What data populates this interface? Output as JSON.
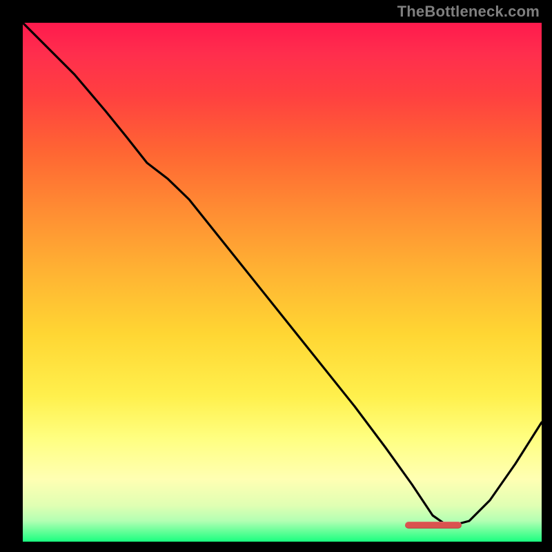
{
  "watermark": {
    "text": "TheBottleneck.com"
  },
  "chart_data": {
    "type": "line",
    "title": "",
    "xlabel": "",
    "ylabel": "",
    "xlim": [
      0,
      100
    ],
    "ylim": [
      0,
      100
    ],
    "grid": false,
    "legend": false,
    "series": [
      {
        "name": "curve",
        "x": [
          0,
          4,
          10,
          16,
          20,
          24,
          28,
          32,
          40,
          48,
          56,
          64,
          70,
          75,
          79,
          82,
          86,
          90,
          95,
          100
        ],
        "values": [
          100,
          96,
          90,
          83,
          78,
          73,
          70,
          66,
          56,
          46,
          36,
          26,
          18,
          11,
          5,
          3,
          4,
          8,
          15,
          23
        ]
      }
    ],
    "annotation_badge": {
      "x_start": 74,
      "x_end": 85,
      "y": 3.5
    },
    "background_gradient": {
      "stops": [
        {
          "pct": 0,
          "color": "#ff1a4d"
        },
        {
          "pct": 25,
          "color": "#ff6633"
        },
        {
          "pct": 60,
          "color": "#ffd633"
        },
        {
          "pct": 88,
          "color": "#ffffb3"
        },
        {
          "pct": 100,
          "color": "#1aff80"
        }
      ]
    }
  }
}
